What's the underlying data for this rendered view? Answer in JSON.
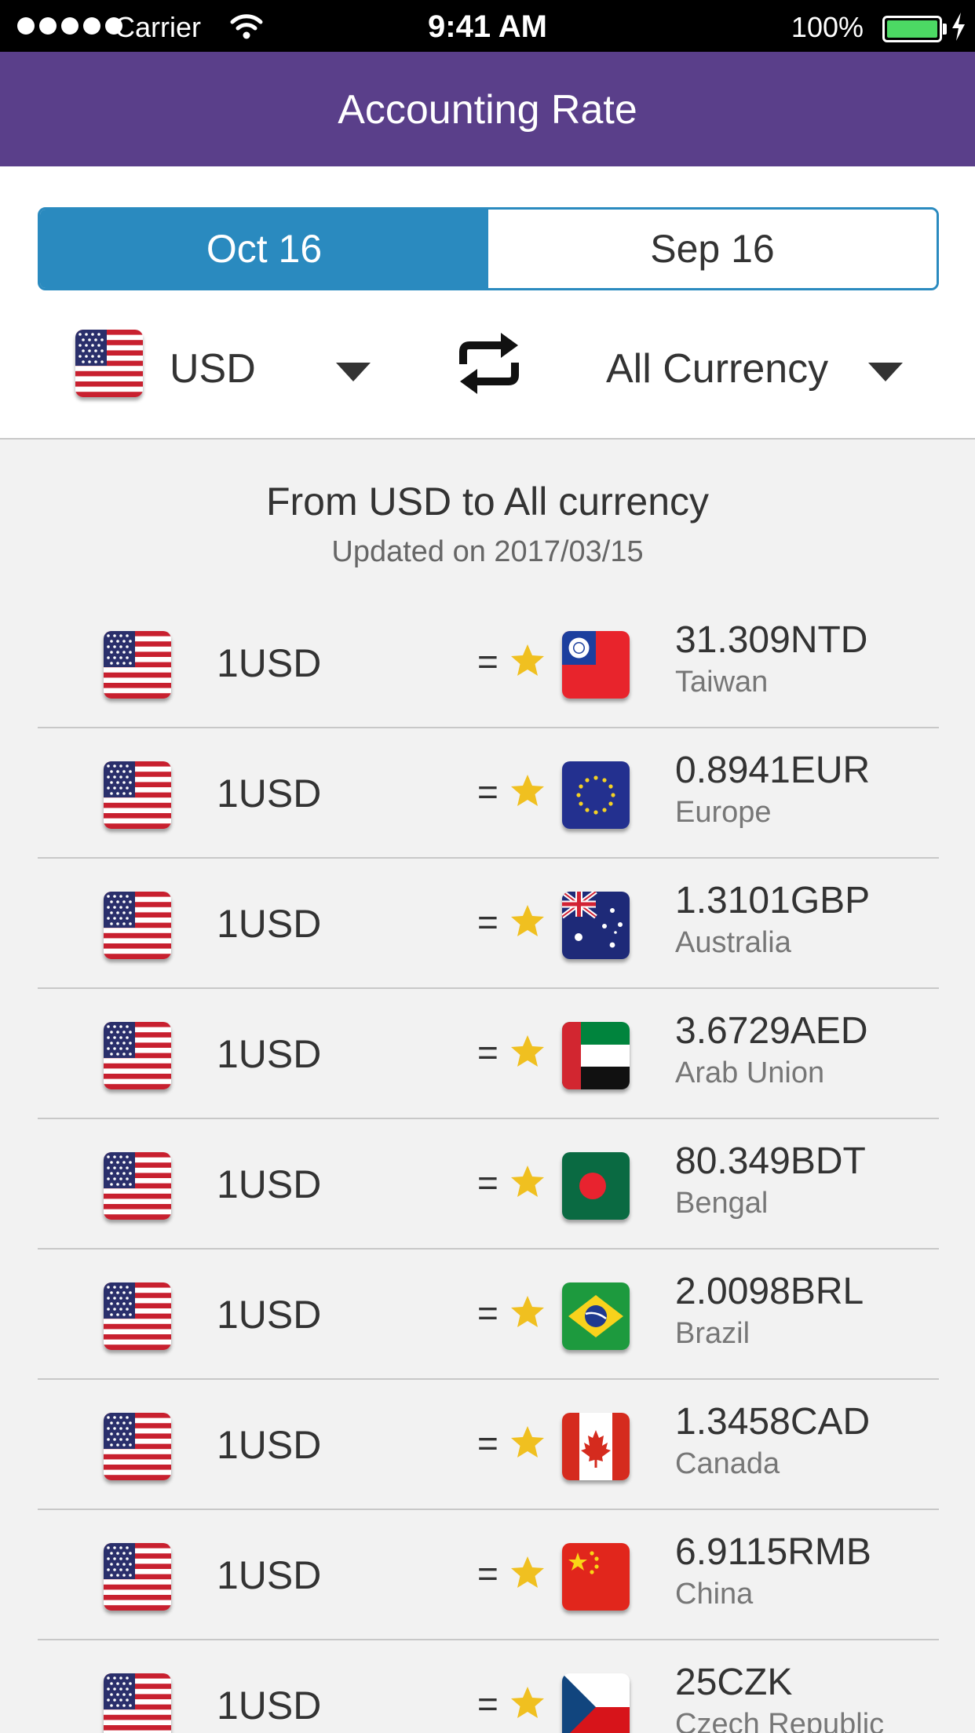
{
  "status_bar": {
    "carrier": "Carrier",
    "time": "9:41 AM",
    "battery": "100%"
  },
  "nav": {
    "title": "Accounting Rate"
  },
  "segments": [
    {
      "label": "Oct 16",
      "active": true
    },
    {
      "label": "Sep 16",
      "active": false
    }
  ],
  "converter": {
    "from_currency": "USD",
    "from_flag": "us-flag-icon",
    "to_label": "All Currency",
    "swap_icon": "swap-arrows-icon"
  },
  "summary": {
    "title": "From USD to All currency",
    "updated": "Updated on 2017/03/15"
  },
  "colors": {
    "nav": "#5a3f8a",
    "accent": "#2a8abf",
    "star": "#f0c020",
    "background": "#f2f2f2"
  },
  "rates": [
    {
      "source": "1USD",
      "equals": "=",
      "rate": "31.309NTD",
      "country": "Taiwan",
      "flag": "taiwan-flag-icon"
    },
    {
      "source": "1USD",
      "equals": "=",
      "rate": "0.8941EUR",
      "country": "Europe",
      "flag": "eu-flag-icon"
    },
    {
      "source": "1USD",
      "equals": "=",
      "rate": "1.3101GBP",
      "country": "Australia",
      "flag": "australia-flag-icon"
    },
    {
      "source": "1USD",
      "equals": "=",
      "rate": "3.6729AED",
      "country": "Arab Union",
      "flag": "uae-flag-icon"
    },
    {
      "source": "1USD",
      "equals": "=",
      "rate": "80.349BDT",
      "country": "Bengal",
      "flag": "bangladesh-flag-icon"
    },
    {
      "source": "1USD",
      "equals": "=",
      "rate": "2.0098BRL",
      "country": "Brazil",
      "flag": "brazil-flag-icon"
    },
    {
      "source": "1USD",
      "equals": "=",
      "rate": "1.3458CAD",
      "country": "Canada",
      "flag": "canada-flag-icon"
    },
    {
      "source": "1USD",
      "equals": "=",
      "rate": "6.9115RMB",
      "country": "China",
      "flag": "china-flag-icon"
    },
    {
      "source": "1USD",
      "equals": "=",
      "rate": "25CZK",
      "country": "Czech Republic",
      "flag": "czech-flag-icon"
    }
  ]
}
